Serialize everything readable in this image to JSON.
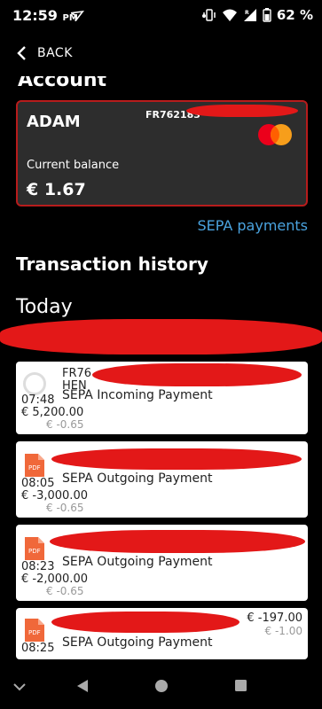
{
  "status": {
    "time": "12:59",
    "ampm": "PM",
    "battery": "62 %"
  },
  "header": {
    "back_label": "BACK"
  },
  "section_title": "Account",
  "card": {
    "name": "ADAM",
    "iban_prefix": "FR762183",
    "balance_label": "Current balance",
    "balance_value": "€ 1.67"
  },
  "sepa_link": "SEPA payments",
  "history_title": "Transaction history",
  "day_title": "Today",
  "transactions": [
    {
      "ref_line1": "FR76",
      "ref_line2": "HEN",
      "time": "07:48",
      "type": "SEPA Incoming Payment",
      "amount": "€ 5,200.00",
      "fee": "€ -0.65",
      "icon": "circle-icon"
    },
    {
      "time": "08:05",
      "type": "SEPA Outgoing Payment",
      "amount": "€ -3,000.00",
      "fee": "€ -0.65",
      "icon": "pdf-icon"
    },
    {
      "time": "08:23",
      "type": "SEPA Outgoing Payment",
      "amount": "€ -2,000.00",
      "fee": "€ -0.65",
      "icon": "pdf-icon"
    },
    {
      "time": "08:25",
      "type": "SEPA Outgoing Payment",
      "amount": "€ -197.00",
      "fee": "€ -1.00",
      "icon": "pdf-icon"
    }
  ],
  "colors": {
    "accent_link": "#4aa3df",
    "card_border": "#b71c1c",
    "redaction": "#e31818",
    "pdf_icon": "#f0683a"
  },
  "pdf_label": "PDF"
}
